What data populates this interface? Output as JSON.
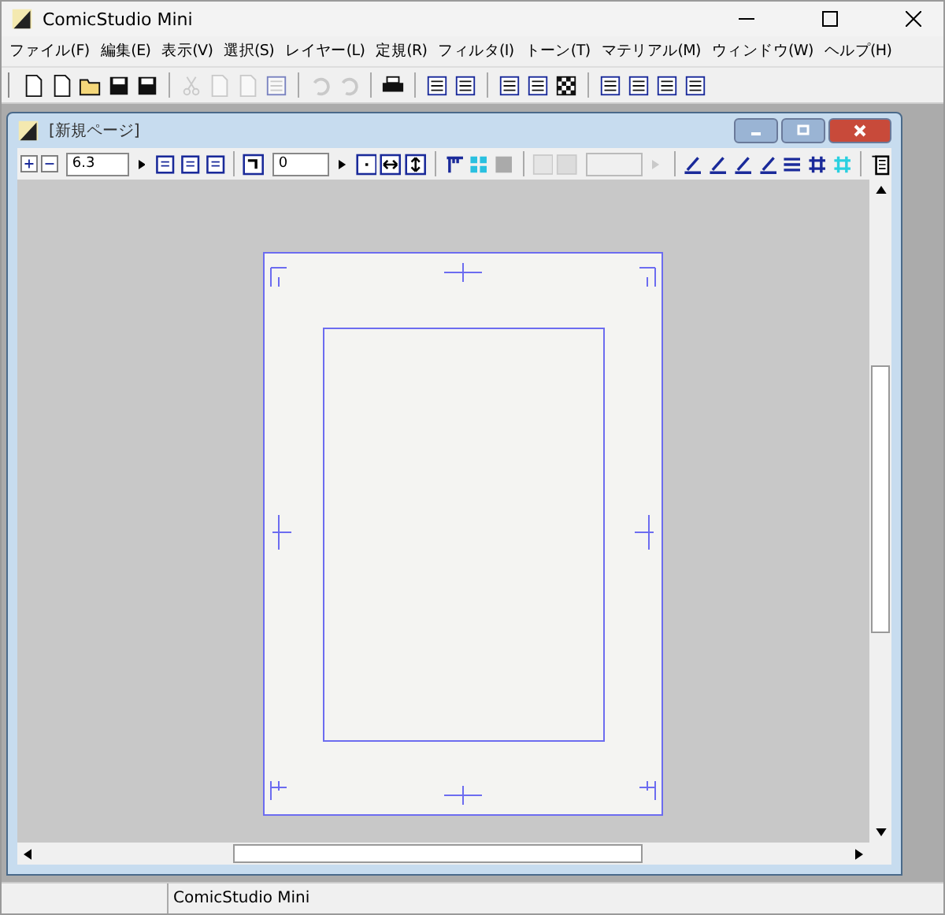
{
  "window": {
    "title": "ComicStudio Mini"
  },
  "menu": [
    "ファイル(F)",
    "編集(E)",
    "表示(V)",
    "選択(S)",
    "レイヤー(L)",
    "定規(R)",
    "フィルタ(I)",
    "トーン(T)",
    "マテリアル(M)",
    "ウィンドウ(W)",
    "ヘルプ(H)"
  ],
  "toolbar": {
    "groups": [
      [
        {
          "disabled": false
        },
        {
          "disabled": false
        },
        {
          "disabled": false
        },
        {
          "disabled": false
        },
        {
          "disabled": false
        }
      ],
      [
        {
          "disabled": true
        },
        {
          "disabled": true
        },
        {
          "disabled": true
        },
        {
          "disabled": true
        }
      ],
      [
        {
          "disabled": true
        },
        {
          "disabled": true
        }
      ],
      [
        {
          "disabled": false
        }
      ],
      [
        {
          "disabled": false
        },
        {
          "disabled": false
        }
      ],
      [
        {
          "disabled": false
        },
        {
          "disabled": false
        },
        {
          "disabled": false
        }
      ],
      [
        {
          "disabled": false
        },
        {
          "disabled": false
        },
        {
          "disabled": false
        },
        {
          "disabled": false
        }
      ]
    ]
  },
  "document": {
    "title": "[新規ページ]",
    "zoom": "6.3",
    "rotation": "0",
    "field_3": {
      "disabled": true
    }
  },
  "status_bar": {
    "text": "ComicStudio Mini"
  }
}
